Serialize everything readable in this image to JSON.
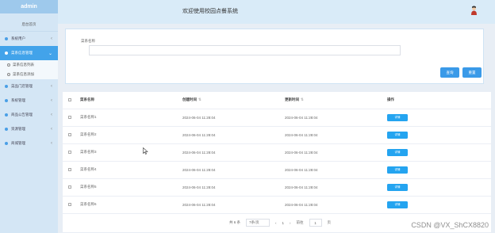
{
  "sidebar": {
    "brand": "admin",
    "home": "后台首页",
    "items": [
      {
        "label": "系统用户"
      },
      {
        "label": "菜系信息管理",
        "active": true
      },
      {
        "label": "菜品门店管理"
      },
      {
        "label": "系统管理"
      },
      {
        "label": "商品公告管理"
      },
      {
        "label": "资源管理"
      },
      {
        "label": "商城管理"
      }
    ],
    "subitems": [
      "菜系信息列表",
      "菜系信息添加"
    ]
  },
  "header": {
    "title": "欢迎使用校园点餐系统"
  },
  "search": {
    "label": "菜系名称",
    "placeholder": "",
    "query_button": "查询",
    "reset_button": "重置"
  },
  "table": {
    "columns": [
      "菜系名称",
      "创建时间",
      "更新时间",
      "操作"
    ],
    "rows": [
      {
        "name": "菜系名称1",
        "created": "2024-06-04 11:28:04",
        "updated": "2024-06-04 11:28:04"
      },
      {
        "name": "菜系名称2",
        "created": "2024-06-04 11:28:04",
        "updated": "2024-06-04 11:28:04"
      },
      {
        "name": "菜系名称3",
        "created": "2024-06-04 11:28:04",
        "updated": "2024-06-04 11:28:04"
      },
      {
        "name": "菜系名称4",
        "created": "2024-06-04 11:28:04",
        "updated": "2024-06-04 11:28:04"
      },
      {
        "name": "菜系名称5",
        "created": "2024-06-04 11:28:04",
        "updated": "2024-06-04 11:28:04"
      },
      {
        "name": "菜系名称6",
        "created": "2024-06-04 11:28:04",
        "updated": "2024-06-04 11:28:04"
      }
    ],
    "detail_label": "详情"
  },
  "pagination": {
    "total": "共 6 条",
    "page_size": "7条/页",
    "current": "1",
    "goto_prefix": "前往",
    "goto_value": "1",
    "goto_suffix": "页"
  },
  "watermark": "CSDN @VX_ShCX8820",
  "colors": {
    "accent": "#42a3ea",
    "button": "#3a9ae8",
    "sidebar": "#d4e6f5"
  }
}
